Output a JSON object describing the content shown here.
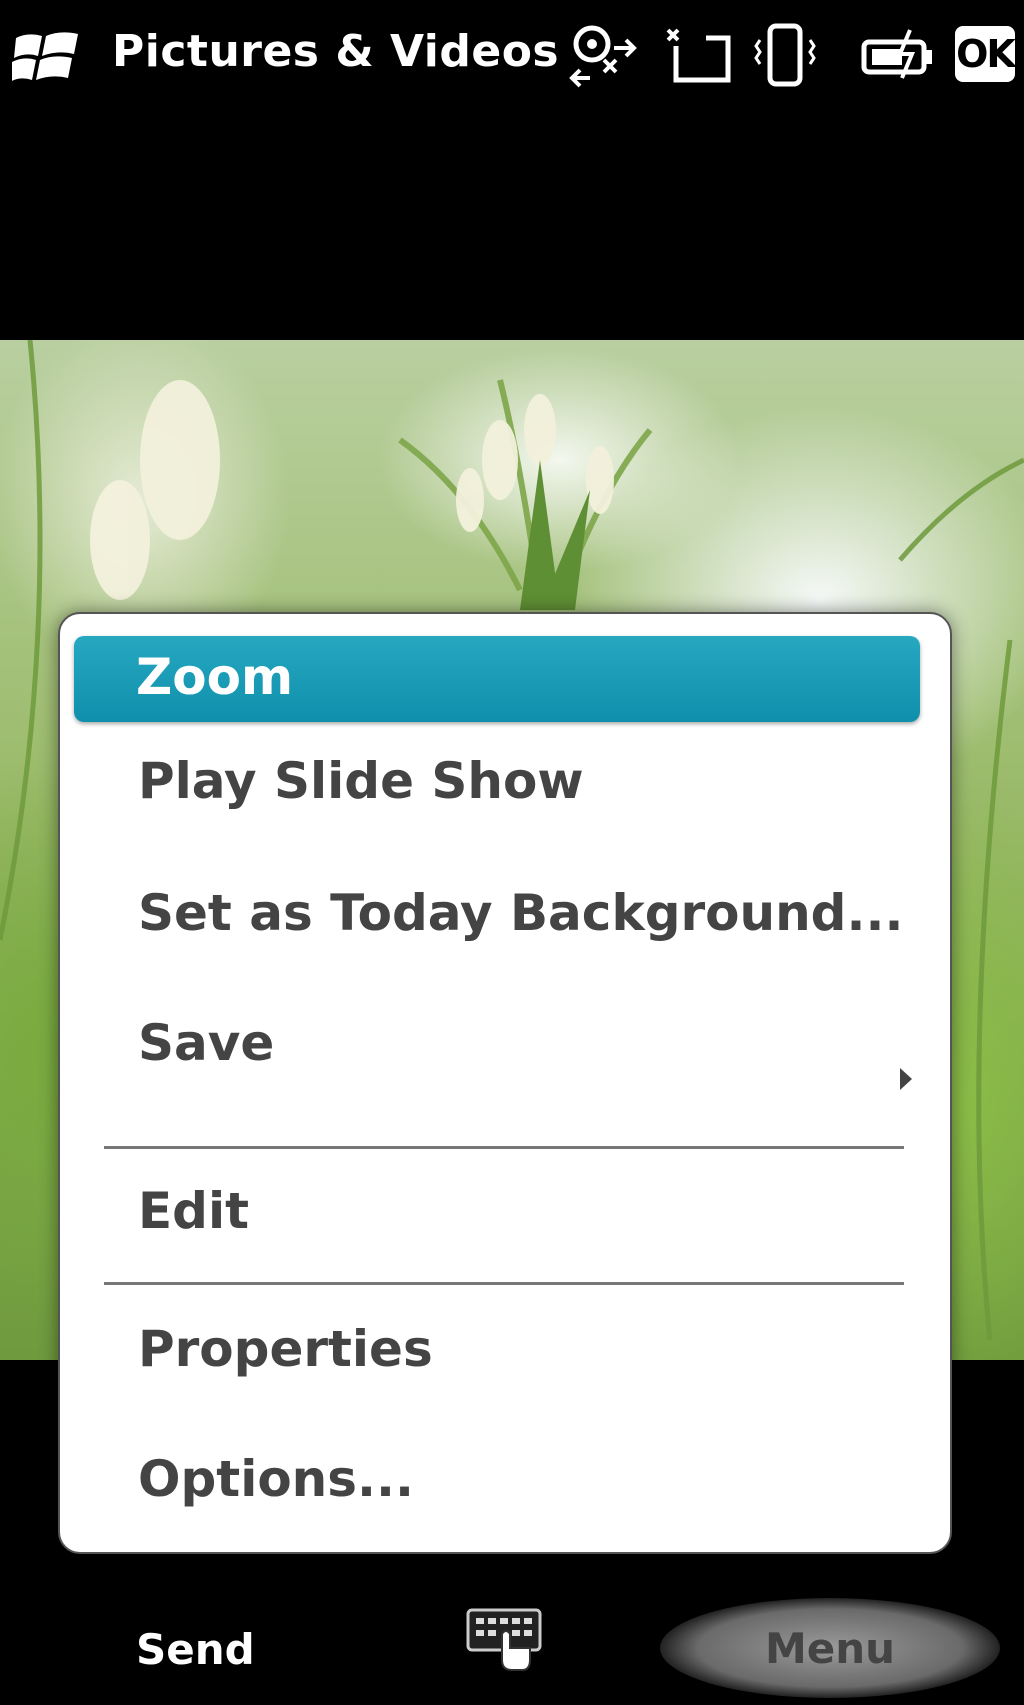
{
  "titlebar": {
    "app_title": "Pictures & Videos",
    "ok_label": "OK",
    "icons": [
      "windows-start-icon",
      "signal-roaming-icon",
      "no-sim-icon",
      "vibrate-icon",
      "battery-charging-icon"
    ]
  },
  "menu": {
    "items": [
      {
        "label": "Zoom",
        "selected": true
      },
      {
        "label": "Play Slide Show"
      },
      {
        "label": "Set as Today Background..."
      },
      {
        "label": "Save",
        "has_submenu": true
      },
      {
        "label": "Edit"
      },
      {
        "label": "Properties"
      },
      {
        "label": "Options..."
      }
    ],
    "accent_color": "#1a9bb5"
  },
  "softkeys": {
    "left": "Send",
    "right": "Menu"
  }
}
